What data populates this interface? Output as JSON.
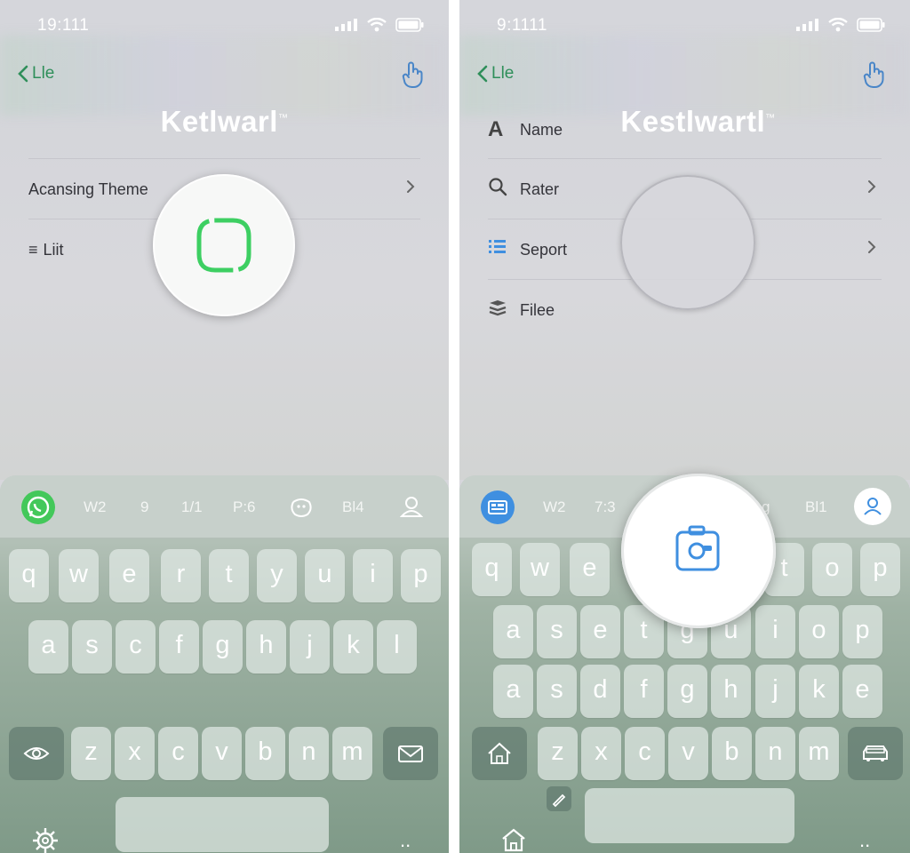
{
  "left": {
    "status_time": "19:111",
    "back_label": "Lle",
    "title": "Ketlwarl",
    "title_mark": "™",
    "rows": [
      {
        "label": "Acansing Theme"
      },
      {
        "label": "Liit"
      }
    ],
    "suggestions": [
      "W2",
      "9",
      "1/1",
      "P:6",
      "Bl4"
    ],
    "keys_row1": [
      "q",
      "w",
      "e",
      "r",
      "t",
      "y",
      "u",
      "i",
      "p"
    ],
    "keys_row2": [
      "a",
      "s",
      "c",
      "f",
      "g",
      "h",
      "j",
      "k",
      "l"
    ],
    "keys_row3": [
      "z",
      "x",
      "c",
      "v",
      "b",
      "n",
      "m"
    ],
    "dots": "..",
    "accent_color": "#3dcf62"
  },
  "right": {
    "status_time": "9:1111",
    "back_label": "Lle",
    "title": "Kestlwartl",
    "title_mark": "™",
    "rows": [
      {
        "label": "Name",
        "icon": "letter-a-icon"
      },
      {
        "label": "Rater",
        "icon": "search-icon"
      },
      {
        "label": "Seport",
        "icon": "list-icon"
      },
      {
        "label": "Filee",
        "icon": "stack-icon"
      }
    ],
    "suggestions": [
      "W2",
      "7:3",
      "g",
      "Bl1"
    ],
    "keys_row1": [
      "q",
      "w",
      "e",
      "t",
      "o",
      "p"
    ],
    "keys_row2": [
      "a",
      "s",
      "e",
      "t",
      "g",
      "u",
      "i",
      "o",
      "p"
    ],
    "keys_row3": [
      "a",
      "s",
      "d",
      "f",
      "g",
      "h",
      "j",
      "k",
      "e"
    ],
    "keys_row4": [
      "z",
      "x",
      "c",
      "v",
      "b",
      "n",
      "m"
    ],
    "dots": "..",
    "accent_color": "#3f8fe0"
  }
}
